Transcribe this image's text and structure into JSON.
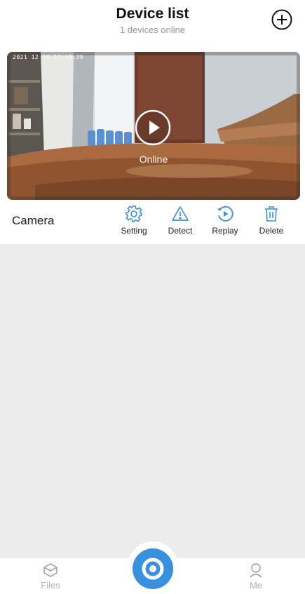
{
  "header": {
    "title": "Device list",
    "subtitle": "1 devices online",
    "add_icon": "plus-circle-icon"
  },
  "device": {
    "timestamp": "2021 12 18 17:45:30",
    "status": "Online",
    "name": "Camera",
    "play_icon": "play-icon"
  },
  "actions": [
    {
      "label": "Setting",
      "icon": "gear-icon"
    },
    {
      "label": "Detect",
      "icon": "warning-icon"
    },
    {
      "label": "Replay",
      "icon": "replay-icon"
    },
    {
      "label": "Delete",
      "icon": "trash-icon"
    }
  ],
  "nav": {
    "files_label": "Files",
    "me_label": "Me",
    "center_icon": "camera-lens-icon"
  },
  "colors": {
    "accent": "#3a90e0",
    "nav_inactive": "#b0b0b0",
    "empty_bg": "#ececec"
  }
}
